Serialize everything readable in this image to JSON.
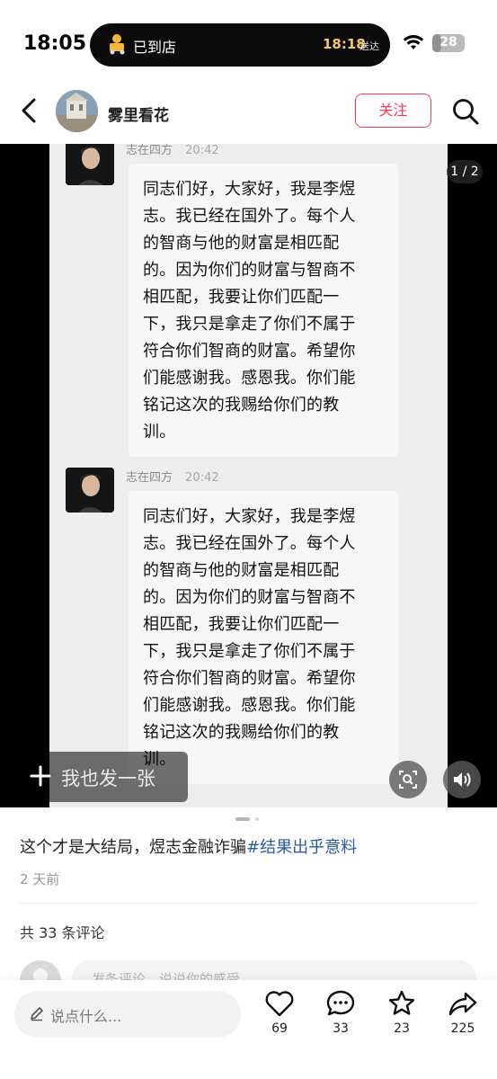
{
  "status_bar": {
    "time": "18:05",
    "island_left": "已到店",
    "island_time": "18:18",
    "island_label": "送达",
    "battery": "28",
    "battery_level": 0.28
  },
  "header": {
    "username": "雾里看花",
    "follow_label": "关注"
  },
  "media": {
    "page_counter": "1 / 2",
    "messages": [
      {
        "sender": "志在四方",
        "time": "20:42",
        "lines": [
          "同志们好，大家好，我是李煜",
          "志。我已经在国外了。每个人",
          "的智商与他的财富是相匹配",
          "的。因为你们的财富与智商不",
          "相匹配，我要让你们匹配一",
          "下，我只是拿走了你们不属于",
          "符合你们智商的财富。希望你",
          "们能感谢我。感恩我。你们能",
          "铭记这次的我赐给你们的教",
          "训。"
        ]
      },
      {
        "sender": "志在四方",
        "time": "20:42",
        "lines": [
          "同志们好，大家好，我是李煜",
          "志。我已经在国外了。每个人",
          "的智商与他的财富是相匹配",
          "的。因为你们的财富与智商不",
          "相匹配，我要让你们匹配一",
          "下，我只是拿走了你们不属于",
          "符合你们智商的财富。希望你",
          "们能感谢我。感恩我。你们能",
          "铭记这次的我赐给你们的教",
          "训。"
        ]
      }
    ],
    "post_bar_label": "我也发一张"
  },
  "post": {
    "caption": "这个才是大结局，煜志金融诈骗",
    "hashtag": "#结果出乎意料",
    "date": "2 天前",
    "comment_count": "共 33 条评论",
    "comment_placeholder": "发条评论，说说你的感受"
  },
  "bottom_bar": {
    "say_placeholder": "说点什么...",
    "likes": "69",
    "comments": "33",
    "stars": "23",
    "shares": "225"
  },
  "colors": {
    "accent": "#f03d56",
    "hashtag": "#2b5aa6"
  },
  "icons": [
    "back-icon",
    "search-icon",
    "wifi-icon",
    "plus-icon",
    "scan-icon",
    "volume-icon",
    "pencil-icon",
    "heart-icon",
    "comment-icon",
    "star-icon",
    "share-icon"
  ]
}
